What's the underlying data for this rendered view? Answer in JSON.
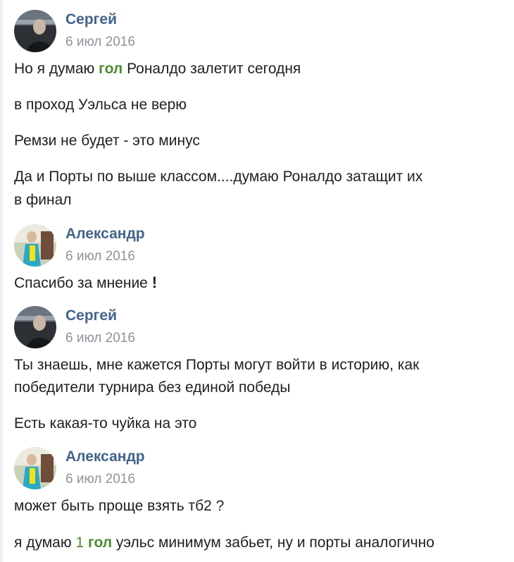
{
  "colors": {
    "author": "#42648b",
    "date": "#8f939a",
    "text": "#1f1f1f",
    "highlight": "#4a8a2e"
  },
  "messages": [
    {
      "author": "Сергей",
      "date": "6 июл 2016",
      "avatar_icon": "user-photo-sergey",
      "lines": {
        "l1_a": "Но я думаю ",
        "l1_hl": "гол",
        "l1_b": " Роналдо залетит сегодня",
        "l2": "в проход Уэльса не верю",
        "l3": "Ремзи не будет - это минус",
        "l4a": "Да и Порты по выше классом....думаю Роналдо затащит их",
        "l4b": "в финал"
      }
    },
    {
      "author": "Александр",
      "date": "6 июл 2016",
      "avatar_icon": "user-photo-alexander",
      "lines": {
        "l1": "Спасибо за мнение",
        "l1_excl": "!"
      }
    },
    {
      "author": "Сергей",
      "date": "6 июл 2016",
      "avatar_icon": "user-photo-sergey",
      "lines": {
        "l1a": "Ты знаешь, мне кажется Порты могут войти в историю, как",
        "l1b": "победители турнира без единой победы",
        "l2": "Есть какая-то чуйка на это"
      }
    },
    {
      "author": "Александр",
      "date": "6 июл 2016",
      "avatar_icon": "user-photo-alexander",
      "lines": {
        "l1": "может быть проще взять тб2 ?",
        "l2_a": "я думаю ",
        "l2_num": "1",
        "l2_sp": " ",
        "l2_hl": "гол",
        "l2_b": " уэльс минимум забьет, ну и порты аналогично"
      }
    }
  ]
}
